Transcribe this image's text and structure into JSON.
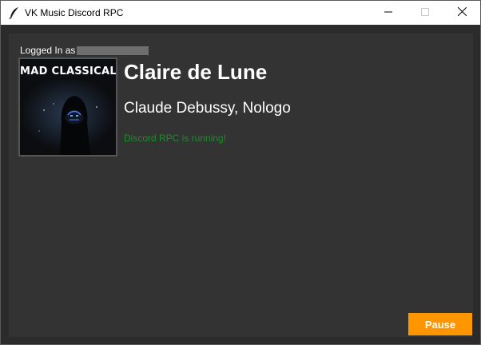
{
  "window": {
    "title": "VK Music Discord RPC",
    "app_icon": "feather-icon",
    "controls": [
      "minimize-icon",
      "maximize-icon",
      "close-icon"
    ]
  },
  "account": {
    "logged_in_label": "Logged In as"
  },
  "album": {
    "art_text": "MAD CLASSICAL"
  },
  "track": {
    "title": "Claire de Lune",
    "artist": "Claude Debussy, Nologo"
  },
  "status": {
    "text": "Discord RPC is running!",
    "color": "#1d8c2a"
  },
  "controls": {
    "pause_label": "Pause",
    "accent_color": "#ff9500"
  },
  "theme": {
    "background": "#333333",
    "titlebar": "#ffffff"
  }
}
